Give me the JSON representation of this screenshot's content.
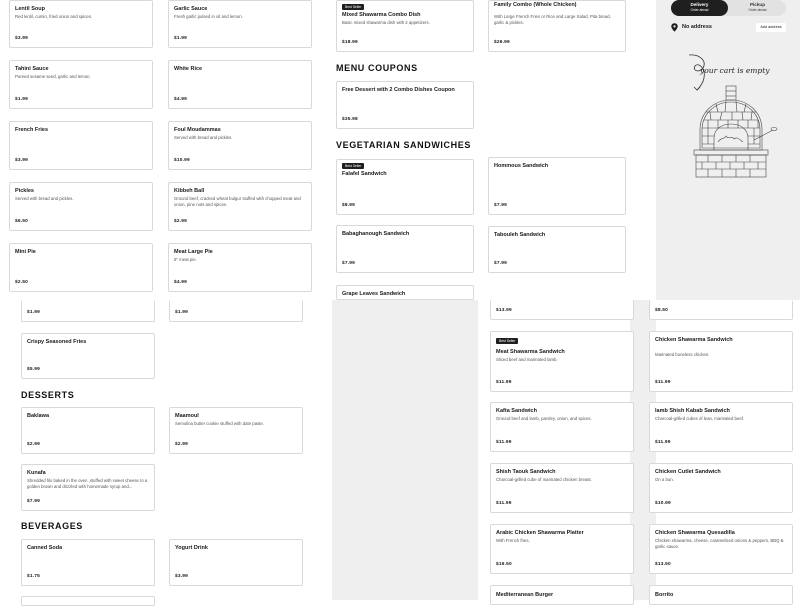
{
  "colors": {
    "accent": "#1f1f1f",
    "panel": "#efefef",
    "border": "#d9d9d9"
  },
  "order_panel": {
    "delivery": {
      "label": "Delivery",
      "sub": "Order ahead"
    },
    "pickup": {
      "label": "Pickup",
      "sub": "Order ahead"
    },
    "address": "No address",
    "add_address": "Add address",
    "empty_cart": "your cart is empty"
  },
  "sections": {
    "menu_coupons": "MENU COUPONS",
    "vegetarian_sandwiches": "VEGETARIAN SANDWICHES",
    "desserts": "DESSERTS",
    "beverages": "BEVERAGES"
  },
  "items": {
    "lentil_soup": {
      "name": "Lentil Soup",
      "desc": "Red lentil, cumin, fried onion and spices.",
      "price": "$3.99"
    },
    "garlic_sauce": {
      "name": "Garlic Sauce",
      "desc": "Fresh garlic pulsed in oil and lemon.",
      "price": "$1.99"
    },
    "mixed_shawarma_combo": {
      "badge": "Best Seller",
      "name": "Mixed Shawarma Combo Dish",
      "desc": "Basic mixed shawarma dish with 2 appetizers.",
      "price": "$18.99"
    },
    "family_combo": {
      "name": "Family Combo (Whole Chicken)",
      "desc": "With Large French Fries or Rice and Large Salad, Pita bread, garlic & pickles.",
      "price": "$26.99"
    },
    "tahini_sauce": {
      "name": "Tahini Sauce",
      "desc": "Pureed sesame seed, garlic and lemon.",
      "price": "$1.99"
    },
    "white_rice": {
      "name": "White Rice",
      "desc": "",
      "price": "$4.99"
    },
    "free_dessert_coupon": {
      "name": "Free Dessert with 2 Combo Dishes Coupon",
      "desc": "",
      "price": "$35.98"
    },
    "french_fries": {
      "name": "French Fries",
      "desc": "",
      "price": "$3.99"
    },
    "foul_moudammas": {
      "name": "Foul Moudammas",
      "desc": "Served with bread and pickles.",
      "price": "$10.99"
    },
    "pickles": {
      "name": "Pickles",
      "desc": "Served with bread and pickles.",
      "price": "$6.50"
    },
    "kibbeh_ball": {
      "name": "Kibbeh Ball",
      "desc": "Ground beef, cracked wheat bulgur stuffed with chopped meat and onion, pine nuts and spices.",
      "price": "$2.99"
    },
    "falafel_sandwich": {
      "badge": "Best Seller",
      "name": "Falafel Sandwich",
      "desc": "",
      "price": "$8.99"
    },
    "hommous_sandwich": {
      "name": "Hommous Sandwich",
      "desc": "",
      "price": "$7.99"
    },
    "mini_pie": {
      "name": "Mini Pie",
      "desc": "",
      "price": "$2.50"
    },
    "meat_large_pie": {
      "name": "Meat Large Pie",
      "desc": "9\" meat pie.",
      "price": "$4.99"
    },
    "babaghanough_sandwich": {
      "name": "Babaghanough Sandwich",
      "desc": "",
      "price": "$7.99"
    },
    "tabouleh_sandwich": {
      "name": "Tabouleh Sandwich",
      "desc": "",
      "price": "$7.99"
    },
    "grape_leaves_sandwich": {
      "name": "Grape Leaves Sandwich",
      "desc": "",
      "price": ""
    },
    "partial_a": {
      "price": "$1.99"
    },
    "partial_b": {
      "price": "$1.99"
    },
    "partial_c": {
      "price": "$13.99"
    },
    "partial_d": {
      "price": "$8.50"
    },
    "crispy_seasoned_fries": {
      "name": "Crispy Seasoned Fries",
      "desc": "",
      "price": "$5.99"
    },
    "meat_shawarma_sandwich": {
      "badge": "Best Seller",
      "name": "Meat Shawarma Sandwich",
      "desc": "Sliced beef and marinated lamb.",
      "price": "$11.99"
    },
    "chicken_shawarma_sandwich": {
      "name": "Chicken Shawarma Sandwich",
      "desc": "Marinated boneless chicken.",
      "price": "$11.99"
    },
    "baklawa": {
      "name": "Baklawa",
      "desc": "",
      "price": "$2.99"
    },
    "maamoul": {
      "name": "Maamoul",
      "desc": "Semolina butter cookie stuffed with date paste.",
      "price": "$2.99"
    },
    "kafta_sandwich": {
      "name": "Kafta Sandwich",
      "desc": "Ground beef and lamb, parsley, onion, and spices.",
      "price": "$11.99"
    },
    "lamb_shish_kabab_sandwich": {
      "name": "lamb Shish Kabab Sandwich",
      "desc": "Charcoal-grilled cubes of lean, marinated beef.",
      "price": "$11.99"
    },
    "kunafa": {
      "name": "Kunafa",
      "desc": "Shredded filo baked in the oven ,stuffed with sweet cheese to a golden brown and drizzled with homemade syrup and...",
      "price": "$7.99"
    },
    "shish_taouk_sandwich": {
      "name": "Shish Taouk Sandwich",
      "desc": "Charcoal-grilled cube of marinated chicken breast.",
      "price": "$11.99"
    },
    "chicken_cutlet_sandwich": {
      "name": "Chicken Cutlet Sandwich",
      "desc": "On a bun.",
      "price": "$10.99"
    },
    "canned_soda": {
      "name": "Canned Soda",
      "desc": "",
      "price": "$1.75"
    },
    "yogurt_drink": {
      "name": "Yogurt Drink",
      "desc": "",
      "price": "$3.99"
    },
    "arabic_chicken_shawarma_platter": {
      "name": "Arabic Chicken Shawarma Platter",
      "desc": "With French fries.",
      "price": "$16.50"
    },
    "chicken_shawarma_quesadilla": {
      "name": "Chicken Shawarma Quesadilla",
      "desc": "Chicken shawarma, cheese, caramelized onions & peppers, BBQ & garlic sauce.",
      "price": "$13.50"
    },
    "mediterranean_burger": {
      "name": "Mediterranean Burger",
      "desc": "",
      "price": ""
    },
    "borrito": {
      "name": "Borrito",
      "desc": "",
      "price": ""
    }
  }
}
